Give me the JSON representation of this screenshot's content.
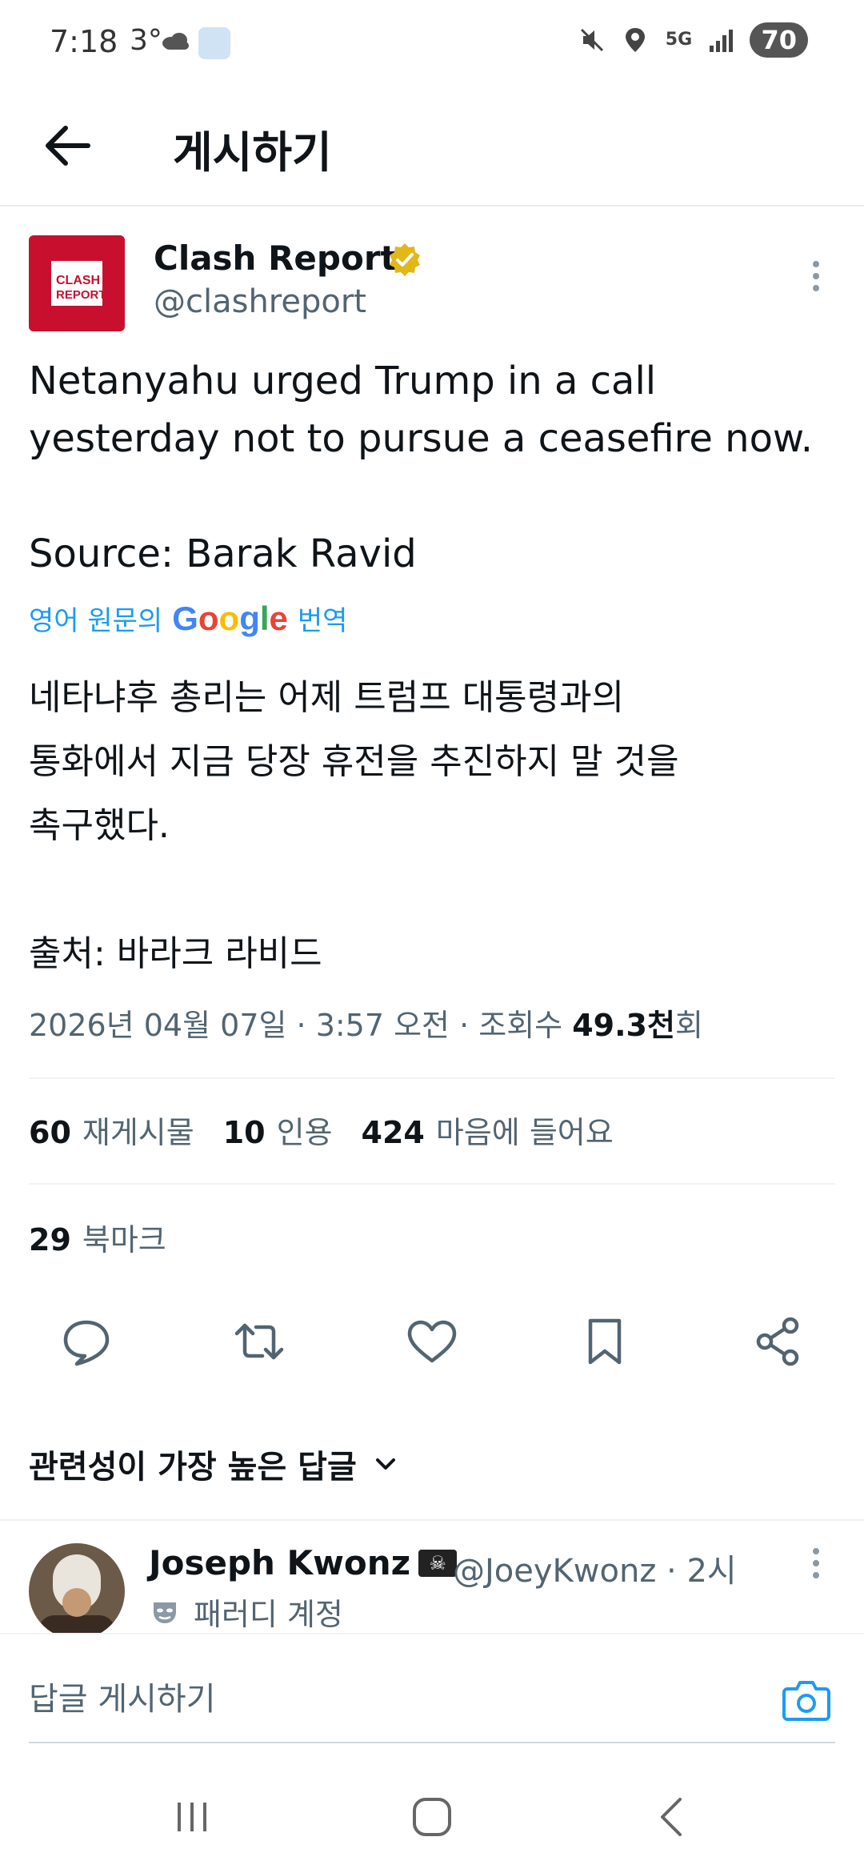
{
  "status_bar": {
    "time": "7:18",
    "temperature": "3°",
    "network": "5G",
    "battery": "70"
  },
  "header": {
    "title": "게시하기"
  },
  "tweet": {
    "author_name": "Clash Report",
    "author_handle": "@clashreport",
    "avatar_text_top": "CLASH",
    "avatar_text_bottom": "REPORT",
    "text": "Netanyahu urged Trump in a call\nyesterday not to pursue a ceasefire now.\n\nSource: Barak Ravid",
    "translate_prefix": "영어 원문의",
    "translate_brand": "Google",
    "translate_suffix": "번역",
    "translated_text": "네타냐후 총리는 어제 트럼프 대통령과의\n통화에서 지금 당장 휴전을 추진하지 말 것을\n촉구했다.\n\n출처: 바라크 라비드",
    "meta_date": "2026년 04월 07일 · 3:57 오전 · 조회수",
    "meta_views": "49.3천",
    "meta_views_suffix": "회",
    "reposts_count": "60",
    "reposts_label": "재게시물",
    "quotes_count": "10",
    "quotes_label": "인용",
    "likes_count": "424",
    "likes_label": "마음에 들어요",
    "bookmarks_count": "29",
    "bookmarks_label": "북마크"
  },
  "replies": {
    "sort_label": "관련성이 가장 높은 답글",
    "first_reply": {
      "name": "Joseph Kwonz",
      "handle": "@JoeyKwonz · 2시",
      "badge": "패러디 계정"
    }
  },
  "composer": {
    "placeholder": "답글 게시하기"
  },
  "colors": {
    "accent": "#1d9bf0",
    "text_primary": "#0f1419",
    "text_secondary": "#536471",
    "avatar_red": "#c8102e",
    "verified_gold": "#e2b719"
  }
}
